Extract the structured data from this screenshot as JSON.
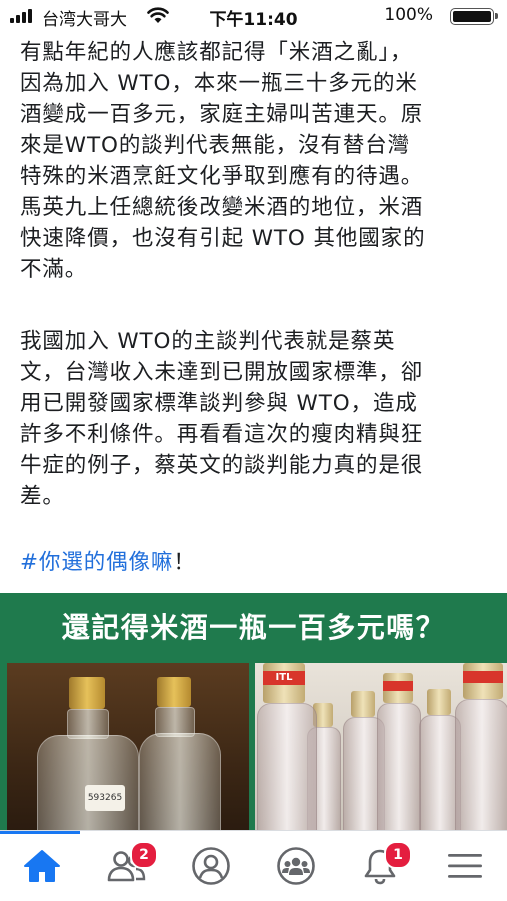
{
  "status_bar": {
    "carrier": "台湾大哥大",
    "time": "下午11:40",
    "battery_pct": "100%",
    "battery_level": 1.0
  },
  "post": {
    "paragraph1": "有點年紀的人應該都記得「米酒之亂」，\n因為加入 WTO，本來一瓶三十多元的米\n酒變成一百多元，家庭主婦叫苦連天。原\n來是WTO的談判代表無能，沒有替台灣\n特殊的米酒烹飪文化爭取到應有的待遇。\n馬英九上任總統後改變米酒的地位，米酒\n快速降價，也沒有引起 WTO 其他國家的\n不滿。",
    "paragraph2": "我國加入 WTO的主談判代表就是蔡英\n文，台灣收入未達到已開放國家標準，卻\n用已開發國家標準談判參與 WTO，造成\n許多不利條件。再看看這次的瘦肉精與狂\n牛症的例子，蔡英文的談判能力真的是很\n差。",
    "hashtag": "#你選的偶像嘛",
    "hashtag_suffix": "！"
  },
  "photo": {
    "title": "還記得米酒一瓶一百多元嗎？",
    "left_bottle_tag": "593265",
    "right_bottle_label": "ITL",
    "banner_color": "#1f7a4d"
  },
  "nav": {
    "friends_badge": "2",
    "notifications_badge": "1",
    "active_color": "#1877f2"
  }
}
